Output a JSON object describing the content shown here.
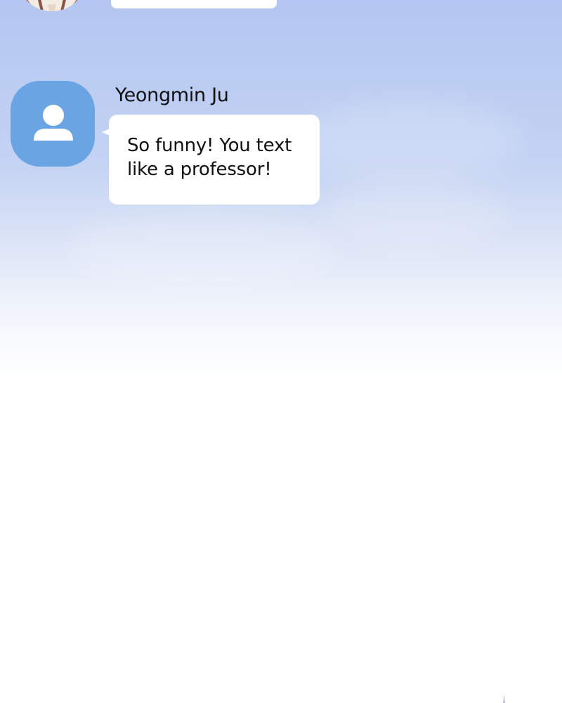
{
  "conversation": {
    "background_color_top": "#b4c6f1",
    "background_color_bottom": "#ffffff",
    "previous_message": {
      "avatar": "illustrated-character-avatar",
      "bubble_text": ""
    },
    "current_message": {
      "sender_name": "Yeongmin Ju",
      "avatar_icon": "person-icon",
      "avatar_color": "#6aa4e2",
      "text": "So funny! You text\nlike a professor!"
    }
  }
}
